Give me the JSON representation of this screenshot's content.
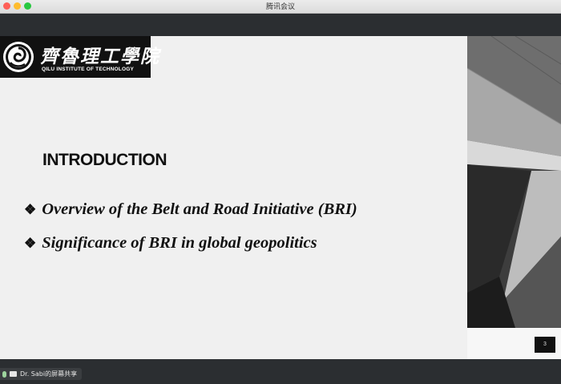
{
  "window": {
    "title": "腾讯会议"
  },
  "slide": {
    "logo_cn": "齊魯理工學院",
    "logo_en": "QILU INSTITUTE OF TECHNOLOGY",
    "title": "INTRODUCTION",
    "bullets": [
      "Overview of the Belt and Road Initiative (BRI)",
      "Significance of BRI in global geopolitics"
    ],
    "bullet_marker": "❖",
    "page_number": "3"
  },
  "share": {
    "label": "Dr. Sabi的屏幕共享"
  },
  "colors": {
    "topbar": "#2b2e31",
    "slide_bg": "#f0f0f0"
  }
}
